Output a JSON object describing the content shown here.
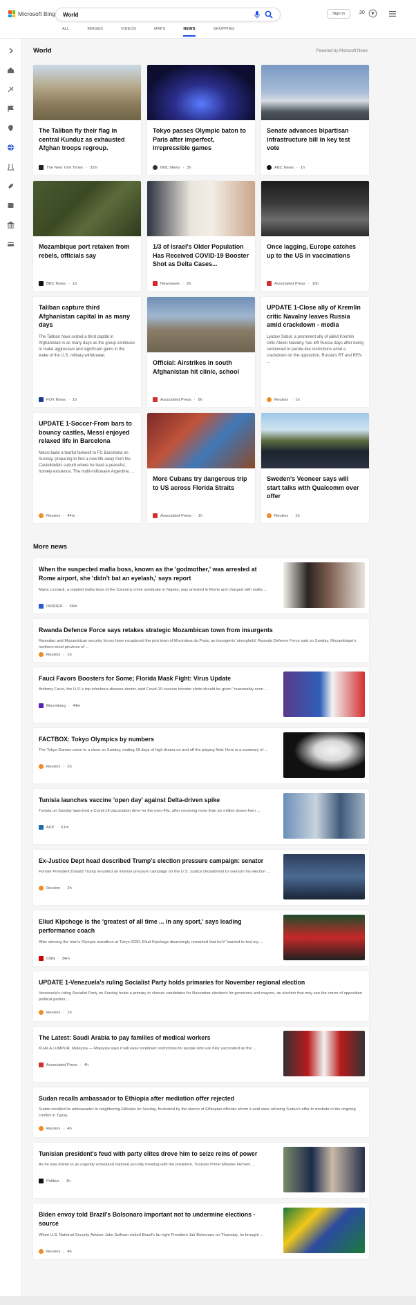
{
  "header": {
    "logo_text": "Microsoft Bing",
    "search_value": "World",
    "tabs": [
      {
        "label": "ALL"
      },
      {
        "label": "IMAGES"
      },
      {
        "label": "VIDEOS"
      },
      {
        "label": "MAPS"
      },
      {
        "label": "NEWS"
      },
      {
        "label": "SHOPPING"
      }
    ],
    "active_tab": "NEWS",
    "signin_label": "Sign in",
    "points": "20"
  },
  "rail_icons": [
    "chevron-right-icon",
    "home-icon",
    "sports-icon",
    "flag-icon",
    "location-icon",
    "globe-icon",
    "science-icon",
    "rocket-icon",
    "entertainment-icon",
    "business-icon",
    "card-icon"
  ],
  "world": {
    "title": "World",
    "powered_by": "Powered by Microsoft News",
    "cards": [
      {
        "title": "The Taliban fly their flag in central Kunduz as exhausted Afghan troops regroup.",
        "source": "The New York Times",
        "time": "32m",
        "desc": ""
      },
      {
        "title": "Tokyo passes Olympic baton to Paris after imperfect, irrepressible games",
        "source": "NBC News",
        "time": "3h",
        "desc": ""
      },
      {
        "title": "Senate advances bipartisan infrastructure bill in key test vote",
        "source": "ABC News",
        "time": "1h",
        "desc": ""
      },
      {
        "title": "Mozambique port retaken from rebels, officials say",
        "source": "BBC News",
        "time": "1h",
        "desc": ""
      },
      {
        "title": "1/3 of Israel's Older Population Has Received COVID-19 Booster Shot as Delta Cases...",
        "source": "Newsweek",
        "time": "2h",
        "desc": ""
      },
      {
        "title": "Once lagging, Europe catches up to the US in vaccinations",
        "source": "Associated Press",
        "time": "10h",
        "desc": ""
      },
      {
        "title": "Taliban capture third Afghanistan capital in as many days",
        "source": "FOX News",
        "time": "1h",
        "desc": "The Taliban have seized a third capital in Afghanistan in as many days as the group continues to make aggressive and significant gains in the wake of the U.S. military withdrawal."
      },
      {
        "title": "Official: Airstrikes in south Afghanistan hit clinic, school",
        "source": "Associated Press",
        "time": "8h",
        "desc": ""
      },
      {
        "title": "UPDATE 1-Close ally of Kremlin critic Navalny leaves Russia amid crackdown - media",
        "source": "Reuters",
        "time": "1h",
        "desc": "Lyubov Sobol, a prominent ally of jailed Kremlin critic Alexei Navalny, has left Russia days after being sentenced to parole-like restrictions amid a crackdown on the opposition, Russia's RT and REN ..."
      },
      {
        "title": "UPDATE 1-Soccer-From bars to bouncy castles, Messi enjoyed relaxed life in Barcelona",
        "source": "Reuters",
        "time": "44m",
        "desc": "Messi bade a tearful farewell to FC Barcelona on Sunday, preparing to find a new life away from the Castelldefels suburb where he lived a peaceful, homely existence. The multi-millionaire Argentine, ..."
      },
      {
        "title": "More Cubans try dangerous trip to US across Florida Straits",
        "source": "Associated Press",
        "time": "1h",
        "desc": ""
      },
      {
        "title": "Sweden's Veoneer says will start talks with Qualcomm over offer",
        "source": "Reuters",
        "time": "1h",
        "desc": ""
      }
    ]
  },
  "more_news": {
    "title": "More news",
    "items": [
      {
        "title": "When the suspected mafia boss, known as the 'godmother,' was arrested at Rome airport, she 'didn't bat an eyelash,' says report",
        "desc": "Maria Licciardi, a reputed mafia boss of the Camorra crime syndicate in Naples, was arrested in Rome and charged with mafia ...",
        "source": "INSIDER",
        "time": "56m"
      },
      {
        "title": "Rwanda Defence Force says retakes strategic Mozambican town from insurgents",
        "desc": "Rwandan and Mozambican security forces have recaptured the port town of Mocimboa da Praia, an insurgents' stronghold, Rwanda Defence Force said on Sunday. Mozambique's northern-most province of ...",
        "source": "Reuters",
        "time": "1h"
      },
      {
        "title": "Fauci Favors Boosters for Some; Florida Mask Fight: Virus Update",
        "desc": "Anthony Fauci, the U.S.'s top infectious-disease doctor, said Covid-19 vaccine booster shots should be given \"reasonably soon ...",
        "source": "Bloomberg",
        "time": "44m"
      },
      {
        "title": "FACTBOX: Tokyo Olympics by numbers",
        "desc": "The Tokyo Games came to a close on Sunday, ending 16 days of high drama on and off the playing field. Here is a summary of ...",
        "source": "Reuters",
        "time": "2h"
      },
      {
        "title": "Tunisia launches vaccine 'open day' against Delta-driven spike",
        "desc": "Tunisia on Sunday launched a Covid-19 vaccination drive for the over-40s, after receiving more than six million doses from ...",
        "source": "AFP",
        "time": "51m"
      },
      {
        "title": "Ex-Justice Dept head described Trump's election pressure campaign: senator",
        "desc": "Former President Donald Trump mounted an intense pressure campaign on the U.S. Justice Department to overturn his election ...",
        "source": "Reuters",
        "time": "2h"
      },
      {
        "title": "Eliud Kipchoge is the 'greatest of all time ... in any sport,' says leading performance coach",
        "desc": "After winning the men's Olympic marathon at Tokyo 2020, Eliud Kipchoge disarmingly remarked that he'd \"wanted to test my ...",
        "source": "CNN",
        "time": "34m"
      },
      {
        "title": "UPDATE 1-Venezuela's ruling Socialist Party holds primaries for November regional election",
        "desc": "Venezuela's ruling Socialist Party on Sunday holds a primary to choose candidates for November elections for governors and mayors, an election that may see the return of opposition political parties ...",
        "source": "Reuters",
        "time": "1h"
      },
      {
        "title": "The Latest: Saudi Arabia to pay families of medical workers",
        "desc": "KUALA LUMPUR, Malaysia — Malaysia says it will ease lockdown restrictions for people who are fully vaccinated as the ...",
        "source": "Associated Press",
        "time": "4h"
      },
      {
        "title": "Sudan recalls ambassador to Ethiopia after mediation offer rejected",
        "desc": "Sudan recalled its ambassador to neighboring Ethiopia on Sunday, frustrated by the stance of Ethiopian officials whom it said were refusing Sudan's offer to mediate in the ongoing conflict in Tigray.",
        "source": "Reuters",
        "time": "4h"
      },
      {
        "title": "Tunisian president's feud with party elites drove him to seize reins of power",
        "desc": "As he was driven to an urgently scheduled national security meeting with the president, Tunisian Prime Minister Hichem ...",
        "source": "Politico",
        "time": "1h"
      },
      {
        "title": "Biden envoy told Brazil's Bolsonaro important not to undermine elections - source",
        "desc": "When U.S. National Security Advisor Jake Sullivan visited Brazil's far-right President Jair Bolsonaro on Thursday, he brought ...",
        "source": "Reuters",
        "time": "4h"
      }
    ]
  },
  "colors": {
    "accent": "#174ae4",
    "reuters": "#f08a24",
    "ap": "#d32f2f"
  }
}
